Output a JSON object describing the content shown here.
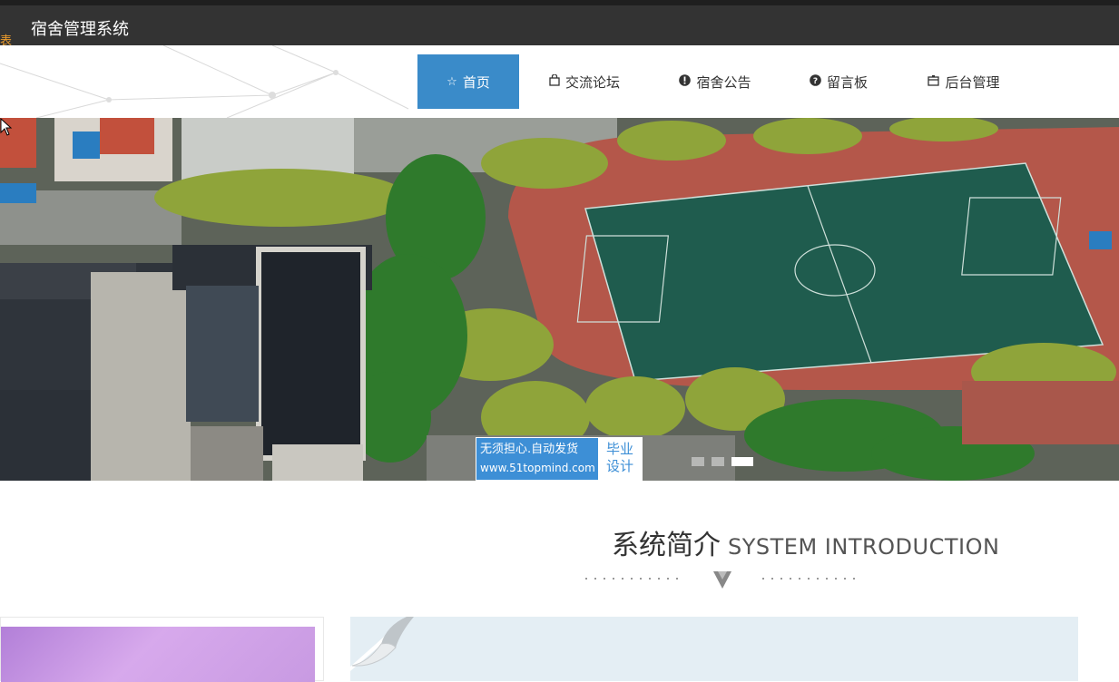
{
  "app": {
    "title": "宿舍管理系统",
    "side_tag": "表"
  },
  "nav": {
    "items": [
      {
        "label": "首页",
        "icon": "star-icon",
        "active": true
      },
      {
        "label": "交流论坛",
        "icon": "bag-icon",
        "active": false
      },
      {
        "label": "宿舍公告",
        "icon": "exclamation-icon",
        "active": false
      },
      {
        "label": "留言板",
        "icon": "question-icon",
        "active": false
      },
      {
        "label": "后台管理",
        "icon": "box-icon",
        "active": false
      }
    ]
  },
  "banner": {
    "image": "campus-aerial-football-field",
    "watermark": {
      "line1": "无须担心.自动发货",
      "line2": "www.51topmind.com",
      "badge_line1": "毕业",
      "badge_line2": "设计"
    },
    "slide_count": 3,
    "active_slide": 3
  },
  "section": {
    "title_zh": "系统简介",
    "title_en": "SYSTEM INTRODUCTION"
  },
  "colors": {
    "topbar": "#333333",
    "nav_active": "#3a8bc9",
    "intro_bg": "#e4eef4"
  }
}
